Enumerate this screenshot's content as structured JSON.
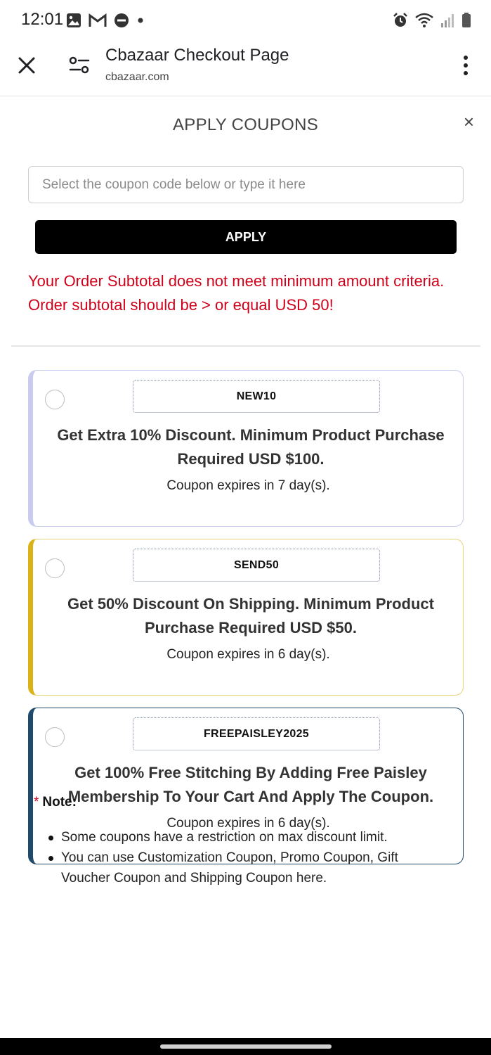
{
  "status_bar": {
    "time": "12:01",
    "left_icons": [
      "image-icon",
      "gmail-icon",
      "do-not-disturb-icon",
      "dot-icon"
    ],
    "right_icons": [
      "alarm-icon",
      "wifi-icon",
      "signal-icon",
      "battery-icon"
    ]
  },
  "tab": {
    "title": "Cbazaar Checkout Page",
    "url": "cbazaar.com"
  },
  "modal": {
    "title": "APPLY COUPONS",
    "close_symbol": "×",
    "input_placeholder": "Select the coupon code below or type it here",
    "input_value": "",
    "apply_label": "APPLY",
    "error_message": "Your Order Subtotal does not meet minimum amount criteria. Order subtotal should be > or equal USD 50!"
  },
  "coupons": [
    {
      "code": "NEW10",
      "description": "Get Extra 10% Discount. Minimum Product Purchase Required USD $100.",
      "expiry": "Coupon expires in 7 day(s).",
      "accent_color": "#c9ccef",
      "selected": false
    },
    {
      "code": "SEND50",
      "description": "Get 50% Discount On Shipping. Minimum Product Purchase Required USD $50.",
      "expiry": "Coupon expires in 6 day(s).",
      "accent_color": "#dcb317",
      "selected": false
    },
    {
      "code": "FREEPAISLEY2025",
      "description": "Get 100% Free Stitching By Adding Free Paisley Membership To Your Cart And Apply The Coupon.",
      "expiry": "Coupon expires in 6 day(s).",
      "accent_color": "#1f4a6b",
      "selected": false
    }
  ],
  "note": {
    "star": "*",
    "label": "Note:",
    "items": [
      "Some coupons have a restriction on max discount limit.",
      "You can use Customization Coupon, Promo Coupon, Gift Voucher Coupon and Shipping Coupon here."
    ]
  },
  "colors": {
    "error": "#d0021b",
    "button_bg": "#000000"
  }
}
